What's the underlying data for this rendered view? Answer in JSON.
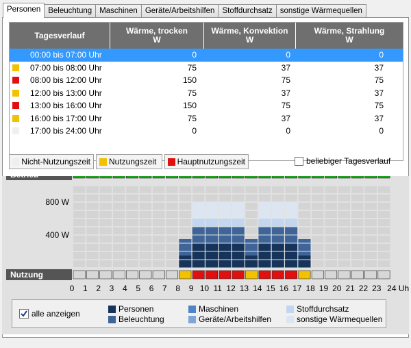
{
  "tabs": [
    "Personen",
    "Beleuchtung",
    "Maschinen",
    "Geräte/Arbeitshilfen",
    "Stoffdurchsatz",
    "sonstige Wärmequellen"
  ],
  "table": {
    "headers": [
      {
        "line1": "Tagesverlauf",
        "line2": ""
      },
      {
        "line1": "Wärme, trocken",
        "line2": "W"
      },
      {
        "line1": "Wärme, Konvektion",
        "line2": "W"
      },
      {
        "line1": "Wärme, Strahlung",
        "line2": "W"
      }
    ],
    "rows": [
      {
        "label": "00:00 bis 07:00 Uhr",
        "color": "#3399ff",
        "v1": "0",
        "v2": "0",
        "v3": "0",
        "selected": true
      },
      {
        "label": "07:00 bis 08:00 Uhr",
        "color": "#f2c200",
        "v1": "75",
        "v2": "37",
        "v3": "37"
      },
      {
        "label": "08:00 bis 12:00 Uhr",
        "color": "#e01010",
        "v1": "150",
        "v2": "75",
        "v3": "75"
      },
      {
        "label": "12:00 bis 13:00 Uhr",
        "color": "#f2c200",
        "v1": "75",
        "v2": "37",
        "v3": "37"
      },
      {
        "label": "13:00 bis 16:00 Uhr",
        "color": "#e01010",
        "v1": "150",
        "v2": "75",
        "v3": "75"
      },
      {
        "label": "16:00 bis 17:00 Uhr",
        "color": "#f2c200",
        "v1": "75",
        "v2": "37",
        "v3": "37"
      },
      {
        "label": "17:00 bis 24:00 Uhr",
        "color": "#efefef",
        "v1": "0",
        "v2": "0",
        "v3": "0"
      }
    ]
  },
  "buttons": [
    {
      "label": "Nicht-Nutzungszeit",
      "color": "#efefef"
    },
    {
      "label": "Nutzungszeit",
      "color": "#f2c200"
    },
    {
      "label": "Hauptnutzungszeit",
      "color": "#e01010"
    }
  ],
  "beliebig_label": "beliebiger Tagesverlauf",
  "chart": {
    "betrieb_label": "Betrieb",
    "nutzung_label": "Nutzung",
    "y_ticks": [
      "800 W",
      "400 W"
    ],
    "x_labels": [
      "0",
      "1",
      "2",
      "3",
      "4",
      "5",
      "6",
      "7",
      "8",
      "9",
      "10",
      "11",
      "12",
      "13",
      "14",
      "15",
      "16",
      "17",
      "18",
      "19",
      "20",
      "21",
      "22",
      "23",
      "24 Uhr"
    ],
    "betrieb_color": "#1aa51a",
    "nutzung": [
      "n",
      "n",
      "n",
      "n",
      "n",
      "n",
      "n",
      "n",
      "y",
      "r",
      "r",
      "r",
      "r",
      "y",
      "r",
      "r",
      "r",
      "y",
      "n",
      "n",
      "n",
      "n",
      "n",
      "n"
    ],
    "colors": {
      "n": "#d7d7d7",
      "y": "#f2c200",
      "r": "#e01010"
    }
  },
  "chart_data": {
    "type": "bar",
    "title": "",
    "xlabel": "Uhr",
    "ylabel": "",
    "ylim": [
      0,
      1000
    ],
    "categories": [
      "0",
      "1",
      "2",
      "3",
      "4",
      "5",
      "6",
      "7",
      "8",
      "9",
      "10",
      "11",
      "12",
      "13",
      "14",
      "15",
      "16",
      "17",
      "18",
      "19",
      "20",
      "21",
      "22",
      "23"
    ],
    "series": [
      {
        "name": "Personen",
        "color": "#16335a",
        "values": [
          0,
          0,
          0,
          0,
          0,
          0,
          0,
          0,
          150,
          300,
          300,
          300,
          300,
          150,
          300,
          300,
          300,
          150,
          0,
          0,
          0,
          0,
          0,
          0
        ]
      },
      {
        "name": "Beleuchtung",
        "color": "#3f6598",
        "values": [
          0,
          0,
          0,
          0,
          0,
          0,
          0,
          0,
          200,
          200,
          200,
          200,
          200,
          200,
          200,
          200,
          200,
          200,
          0,
          0,
          0,
          0,
          0,
          0
        ]
      },
      {
        "name": "Maschinen",
        "color": "#4e85c6",
        "values": [
          0,
          0,
          0,
          0,
          0,
          0,
          0,
          0,
          0,
          0,
          0,
          0,
          0,
          0,
          0,
          0,
          0,
          0,
          0,
          0,
          0,
          0,
          0,
          0
        ]
      },
      {
        "name": "Geräte/Arbeitshilfen",
        "color": "#7fa6d5",
        "values": [
          0,
          0,
          0,
          0,
          0,
          0,
          0,
          0,
          0,
          0,
          0,
          0,
          0,
          0,
          0,
          0,
          0,
          0,
          0,
          0,
          0,
          0,
          0,
          0
        ]
      },
      {
        "name": "Stoffdurchsatz",
        "color": "#c3d6ef",
        "values": [
          0,
          0,
          0,
          0,
          0,
          0,
          0,
          0,
          0,
          100,
          100,
          100,
          100,
          0,
          100,
          100,
          100,
          0,
          0,
          0,
          0,
          0,
          0,
          0
        ]
      },
      {
        "name": "sonstige Wärmequellen",
        "color": "#dce6f3",
        "values": [
          0,
          0,
          0,
          0,
          0,
          0,
          0,
          0,
          0,
          200,
          200,
          200,
          200,
          0,
          200,
          200,
          200,
          0,
          0,
          0,
          0,
          0,
          0,
          0
        ]
      }
    ]
  },
  "legend": {
    "alle_label": "alle anzeigen",
    "items": [
      {
        "label": "Personen",
        "color": "#16335a"
      },
      {
        "label": "Beleuchtung",
        "color": "#3f6598"
      },
      {
        "label": "Maschinen",
        "color": "#4e85c6"
      },
      {
        "label": "Geräte/Arbeitshilfen",
        "color": "#7fa6d5"
      },
      {
        "label": "Stoffdurchsatz",
        "color": "#c3d6ef"
      },
      {
        "label": "sonstige Wärmequellen",
        "color": "#dce6f3"
      }
    ]
  }
}
